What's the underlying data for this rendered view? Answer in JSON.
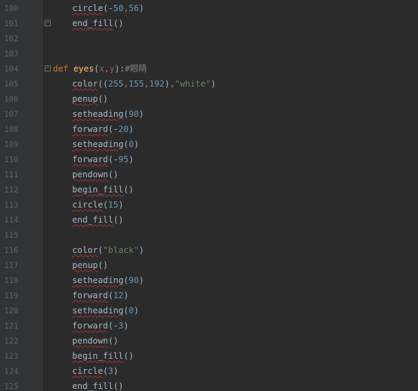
{
  "editor": {
    "lines": [
      {
        "num": "100",
        "tokens": [
          {
            "t": "        ",
            "c": "plain"
          },
          {
            "t": "circle",
            "c": "call"
          },
          {
            "t": "(-",
            "c": "plain"
          },
          {
            "t": "50",
            "c": "num"
          },
          {
            "t": ",",
            "c": "comma"
          },
          {
            "t": "56",
            "c": "num"
          },
          {
            "t": ")",
            "c": "plain"
          }
        ]
      },
      {
        "num": "101",
        "fold": "end",
        "tokens": [
          {
            "t": "        ",
            "c": "plain"
          },
          {
            "t": "end_fill",
            "c": "call"
          },
          {
            "t": "()",
            "c": "plain"
          }
        ]
      },
      {
        "num": "102",
        "tokens": []
      },
      {
        "num": "103",
        "tokens": []
      },
      {
        "num": "104",
        "fold": "start",
        "tokens": [
          {
            "t": "def ",
            "c": "kw"
          },
          {
            "t": "eyes",
            "c": "fn"
          },
          {
            "t": "(",
            "c": "plain"
          },
          {
            "t": "x",
            "c": "param"
          },
          {
            "t": ",",
            "c": "comma"
          },
          {
            "t": "y",
            "c": "param"
          },
          {
            "t": "):",
            "c": "plain"
          },
          {
            "t": "#眼睛",
            "c": "cm"
          }
        ]
      },
      {
        "num": "105",
        "tokens": [
          {
            "t": "    ",
            "c": "plain"
          },
          {
            "t": "color",
            "c": "call"
          },
          {
            "t": "((",
            "c": "plain"
          },
          {
            "t": "255",
            "c": "num"
          },
          {
            "t": ",",
            "c": "comma"
          },
          {
            "t": "155",
            "c": "num"
          },
          {
            "t": ",",
            "c": "comma"
          },
          {
            "t": "192",
            "c": "num"
          },
          {
            "t": ")",
            "c": "plain"
          },
          {
            "t": ",",
            "c": "comma"
          },
          {
            "t": "\"white\"",
            "c": "str"
          },
          {
            "t": ")",
            "c": "plain"
          }
        ]
      },
      {
        "num": "106",
        "tokens": [
          {
            "t": "    ",
            "c": "plain"
          },
          {
            "t": "penup",
            "c": "call"
          },
          {
            "t": "()",
            "c": "plain"
          }
        ]
      },
      {
        "num": "107",
        "tokens": [
          {
            "t": "    ",
            "c": "plain"
          },
          {
            "t": "setheading",
            "c": "call"
          },
          {
            "t": "(",
            "c": "plain"
          },
          {
            "t": "90",
            "c": "num"
          },
          {
            "t": ")",
            "c": "plain"
          }
        ]
      },
      {
        "num": "108",
        "tokens": [
          {
            "t": "    ",
            "c": "plain"
          },
          {
            "t": "forward",
            "c": "call"
          },
          {
            "t": "(-",
            "c": "plain"
          },
          {
            "t": "20",
            "c": "num"
          },
          {
            "t": ")",
            "c": "plain"
          }
        ]
      },
      {
        "num": "109",
        "tokens": [
          {
            "t": "    ",
            "c": "plain"
          },
          {
            "t": "setheading",
            "c": "call"
          },
          {
            "t": "(",
            "c": "plain"
          },
          {
            "t": "0",
            "c": "num"
          },
          {
            "t": ")",
            "c": "plain"
          }
        ]
      },
      {
        "num": "110",
        "tokens": [
          {
            "t": "    ",
            "c": "plain"
          },
          {
            "t": "forward",
            "c": "call"
          },
          {
            "t": "(-",
            "c": "plain"
          },
          {
            "t": "95",
            "c": "num"
          },
          {
            "t": ")",
            "c": "plain"
          }
        ]
      },
      {
        "num": "111",
        "tokens": [
          {
            "t": "    ",
            "c": "plain"
          },
          {
            "t": "pendown",
            "c": "call"
          },
          {
            "t": "()",
            "c": "plain"
          }
        ]
      },
      {
        "num": "112",
        "tokens": [
          {
            "t": "    ",
            "c": "plain"
          },
          {
            "t": "begin_fill",
            "c": "call"
          },
          {
            "t": "()",
            "c": "plain"
          }
        ]
      },
      {
        "num": "113",
        "tokens": [
          {
            "t": "    ",
            "c": "plain"
          },
          {
            "t": "circle",
            "c": "call"
          },
          {
            "t": "(",
            "c": "plain"
          },
          {
            "t": "15",
            "c": "num"
          },
          {
            "t": ")",
            "c": "plain"
          }
        ]
      },
      {
        "num": "114",
        "tokens": [
          {
            "t": "    ",
            "c": "plain"
          },
          {
            "t": "end_fill",
            "c": "call"
          },
          {
            "t": "()",
            "c": "plain"
          }
        ]
      },
      {
        "num": "115",
        "tokens": []
      },
      {
        "num": "116",
        "tokens": [
          {
            "t": "    ",
            "c": "plain"
          },
          {
            "t": "color",
            "c": "call"
          },
          {
            "t": "(",
            "c": "plain"
          },
          {
            "t": "\"black\"",
            "c": "str"
          },
          {
            "t": ")",
            "c": "plain"
          }
        ]
      },
      {
        "num": "117",
        "tokens": [
          {
            "t": "    ",
            "c": "plain"
          },
          {
            "t": "penup",
            "c": "call"
          },
          {
            "t": "()",
            "c": "plain"
          }
        ]
      },
      {
        "num": "118",
        "tokens": [
          {
            "t": "    ",
            "c": "plain"
          },
          {
            "t": "setheading",
            "c": "call"
          },
          {
            "t": "(",
            "c": "plain"
          },
          {
            "t": "90",
            "c": "num"
          },
          {
            "t": ")",
            "c": "plain"
          }
        ]
      },
      {
        "num": "119",
        "tokens": [
          {
            "t": "    ",
            "c": "plain"
          },
          {
            "t": "forward",
            "c": "call"
          },
          {
            "t": "(",
            "c": "plain"
          },
          {
            "t": "12",
            "c": "num"
          },
          {
            "t": ")",
            "c": "plain"
          }
        ]
      },
      {
        "num": "120",
        "tokens": [
          {
            "t": "    ",
            "c": "plain"
          },
          {
            "t": "setheading",
            "c": "call"
          },
          {
            "t": "(",
            "c": "plain"
          },
          {
            "t": "0",
            "c": "num"
          },
          {
            "t": ")",
            "c": "plain"
          }
        ]
      },
      {
        "num": "121",
        "tokens": [
          {
            "t": "    ",
            "c": "plain"
          },
          {
            "t": "forward",
            "c": "call"
          },
          {
            "t": "(-",
            "c": "plain"
          },
          {
            "t": "3",
            "c": "num"
          },
          {
            "t": ")",
            "c": "plain"
          }
        ]
      },
      {
        "num": "122",
        "tokens": [
          {
            "t": "    ",
            "c": "plain"
          },
          {
            "t": "pendown",
            "c": "call"
          },
          {
            "t": "()",
            "c": "plain"
          }
        ]
      },
      {
        "num": "123",
        "tokens": [
          {
            "t": "    ",
            "c": "plain"
          },
          {
            "t": "begin_fill",
            "c": "call"
          },
          {
            "t": "()",
            "c": "plain"
          }
        ]
      },
      {
        "num": "124",
        "tokens": [
          {
            "t": "    ",
            "c": "plain"
          },
          {
            "t": "circle",
            "c": "call"
          },
          {
            "t": "(",
            "c": "plain"
          },
          {
            "t": "3",
            "c": "num"
          },
          {
            "t": ")",
            "c": "plain"
          }
        ]
      },
      {
        "num": "125",
        "tokens": [
          {
            "t": "    ",
            "c": "plain"
          },
          {
            "t": "end_fill",
            "c": "call"
          },
          {
            "t": "()",
            "c": "plain"
          }
        ]
      }
    ]
  },
  "theme": {
    "background": "#2b2b2b",
    "gutter": "#313335",
    "keyword": "#cc7832",
    "function": "#ffc66d",
    "number": "#6897bb",
    "string": "#6a8759",
    "comment": "#808080",
    "text": "#a9b7c6"
  },
  "icons": {
    "fold_start": "fold-collapse-icon",
    "fold_end": "fold-end-icon"
  }
}
